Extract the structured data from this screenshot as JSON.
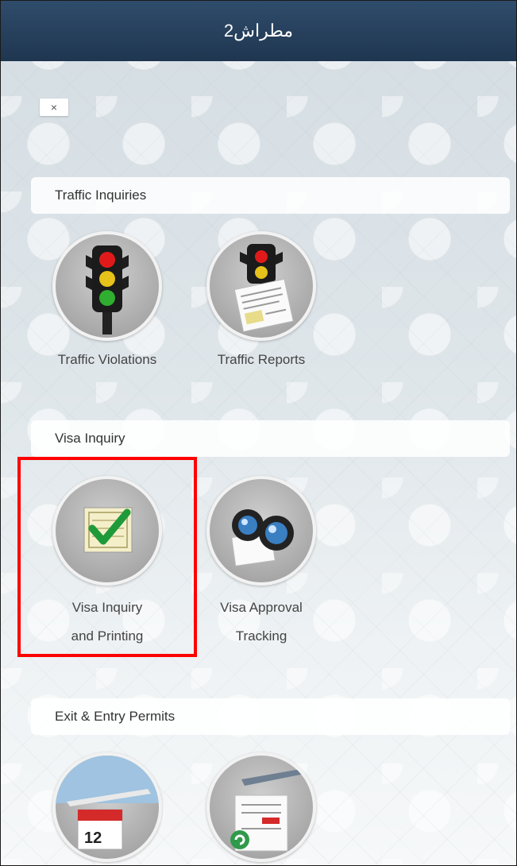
{
  "header": {
    "title": "مطراش2"
  },
  "close_button": {
    "label": "×"
  },
  "sections": [
    {
      "title": "Traffic Inquiries",
      "tiles": [
        {
          "label": "Traffic Violations",
          "icon": "traffic-light-icon"
        },
        {
          "label": "Traffic Reports",
          "icon": "traffic-report-icon"
        }
      ]
    },
    {
      "title": "Visa Inquiry",
      "tiles": [
        {
          "label_line1": "Visa Inquiry",
          "label_line2": "and Printing",
          "icon": "visa-checkmark-document-icon"
        },
        {
          "label_line1": "Visa Approval",
          "label_line2": "Tracking",
          "icon": "binoculars-icon"
        }
      ]
    },
    {
      "title": "Exit & Entry Permits",
      "tiles": [
        {
          "icon": "airplane-calendar-icon",
          "calendar_day": "12"
        },
        {
          "icon": "airplane-document-icon"
        }
      ]
    }
  ],
  "colors": {
    "header_bg": "#1f3650",
    "highlight": "#ff0000"
  }
}
